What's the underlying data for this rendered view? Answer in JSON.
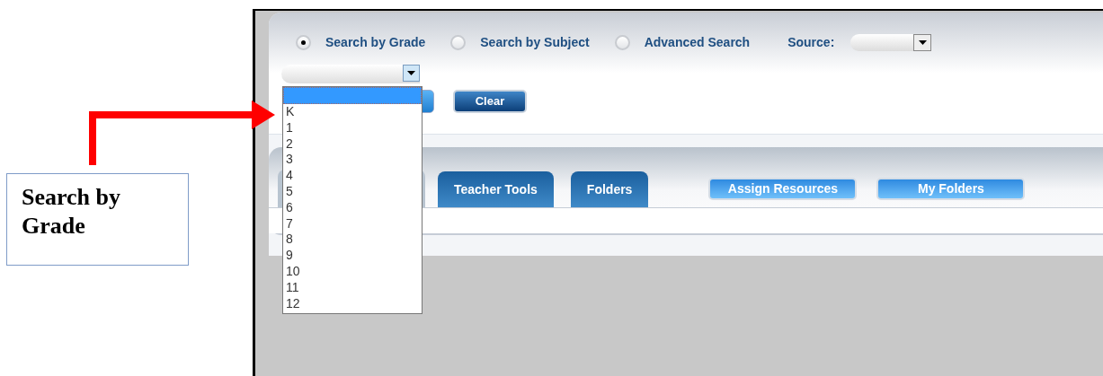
{
  "callout": {
    "text": "Search by Grade"
  },
  "search_modes": [
    {
      "label": "Search by Grade",
      "selected": true
    },
    {
      "label": "Search by Subject",
      "selected": false
    },
    {
      "label": "Advanced Search",
      "selected": false
    }
  ],
  "source": {
    "label": "Source:"
  },
  "grade_dropdown": {
    "expanded": true,
    "blank_row_highlighted": true,
    "items": [
      "K",
      "1",
      "2",
      "3",
      "4",
      "5",
      "6",
      "7",
      "8",
      "9",
      "10",
      "11",
      "12"
    ]
  },
  "buttons": [
    {
      "label": "Clear"
    }
  ],
  "tabs": [
    {
      "label": "Teacher Tools",
      "selected": false
    },
    {
      "label": "Folders",
      "selected": false
    }
  ],
  "actions": [
    {
      "label": "Assign Resources"
    },
    {
      "label": "My Folders"
    }
  ]
}
